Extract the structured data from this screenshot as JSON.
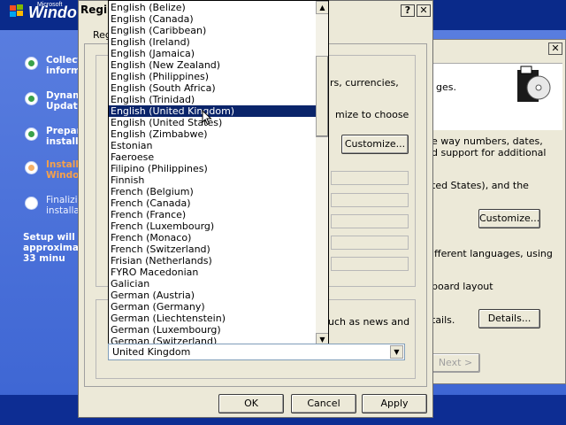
{
  "setup": {
    "logo_small": "Microsoft",
    "logo": "Windo",
    "steps": [
      {
        "label": "Collect\ninform",
        "state": "done"
      },
      {
        "label": "Dynam\nUpdate",
        "state": "done"
      },
      {
        "label": "Prepar\ninstalla",
        "state": "done"
      },
      {
        "label": "Install\nWindo",
        "state": "current"
      },
      {
        "label": "Finalizi\ninstallat",
        "state": "pending"
      }
    ],
    "time_text": "Setup will c\napproximat\n33 minu"
  },
  "bg_dialog": {
    "close_label": "✕",
    "texts": [
      "rs, currencies,",
      "mize to choose",
      "e way numbers, dates,",
      "d support for additional",
      "ted States), and the",
      "ifferent languages, using",
      "board layout",
      "uch as news and",
      "tails."
    ],
    "customize1_label": "Customize...",
    "customize2_label": "Customize...",
    "details_label": "Details...",
    "next_label": "Next >"
  },
  "dialog": {
    "title": "Regi",
    "help_label": "?",
    "close_label": "✕",
    "tab_label": "Reg",
    "ok_label": "OK",
    "cancel_label": "Cancel",
    "apply_label": "Apply"
  },
  "dropdown": {
    "items": [
      "English (Belize)",
      "English (Canada)",
      "English (Caribbean)",
      "English (Ireland)",
      "English (Jamaica)",
      "English (New Zealand)",
      "English (Philippines)",
      "English (South Africa)",
      "English (Trinidad)",
      "English (United Kingdom)",
      "English (United States)",
      "English (Zimbabwe)",
      "Estonian",
      "Faeroese",
      "Filipino (Philippines)",
      "Finnish",
      "French (Belgium)",
      "French (Canada)",
      "French (France)",
      "French (Luxembourg)",
      "French (Monaco)",
      "French (Switzerland)",
      "Frisian (Netherlands)",
      "FYRO Macedonian",
      "Galician",
      "German (Austria)",
      "German (Germany)",
      "German (Liechtenstein)",
      "German (Luxembourg)",
      "German (Switzerland)"
    ],
    "selected_index": 9,
    "scroll_up": "▲",
    "scroll_down": "▼"
  },
  "combo": {
    "value": "United Kingdom",
    "arrow": "▼"
  },
  "colors": {
    "selection": "#0a246a",
    "dialog_bg": "#ece9d8",
    "setup_bg": "#3f67d4",
    "current_step": "#f6a14a"
  }
}
